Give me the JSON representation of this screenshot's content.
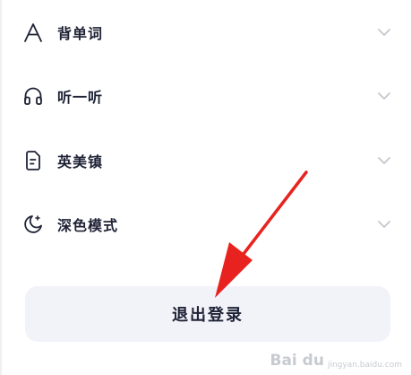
{
  "menu": {
    "items": [
      {
        "label": "背单词",
        "icon": "letter-a-icon"
      },
      {
        "label": "听一听",
        "icon": "headphones-icon"
      },
      {
        "label": "英美镇",
        "icon": "document-icon"
      },
      {
        "label": "深色模式",
        "icon": "moon-icon"
      }
    ]
  },
  "logout": {
    "label": "退出登录"
  },
  "watermark": {
    "main": "Bai du",
    "sub": "jingyan.baidu.com"
  },
  "colors": {
    "text": "#1e2235",
    "chevron": "#c3c7cf",
    "button_bg": "#f2f3f9",
    "annotation_arrow": "#e8231f"
  }
}
